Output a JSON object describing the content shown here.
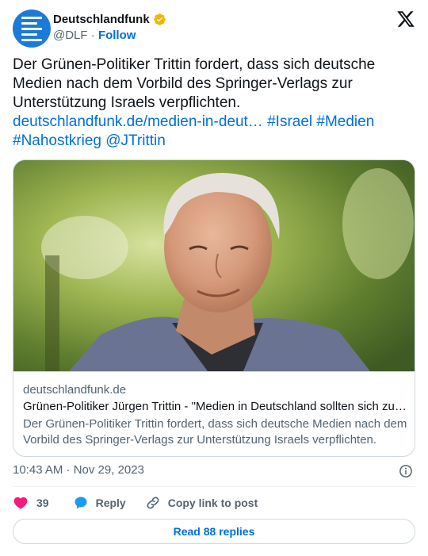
{
  "author": {
    "display_name": "Deutschlandfunk",
    "handle": "@DLF",
    "separator": " · ",
    "follow_label": "Follow",
    "verified_badge_color": "#f4b400",
    "avatar_color": "#1c7bd6"
  },
  "platform_icon": "x-logo-icon",
  "tweet": {
    "text": "Der Grünen-Politiker Trittin fordert, dass sich deutsche Medien nach dem Vorbild des Springer-Verlags zur Unterstützung Israels verpflichten.",
    "link": "deutschlandfunk.de/medien-in-deut…",
    "hashtags": [
      "#Israel",
      "#Medien",
      "#Nahostkrieg"
    ],
    "mention": "@JTrittin"
  },
  "card": {
    "image": "portrait-photo",
    "domain": "deutschlandfunk.de",
    "title": "Grünen-Politiker Jürgen Trittin - \"Medien in Deutschland sollten sich zur…",
    "description": "Der Grünen-Politiker Trittin fordert, dass sich deutsche Medien nach dem Vorbild des Springer-Verlags zur Unterstützung Israels verpflichten."
  },
  "meta": {
    "time": "10:43 AM · Nov 29, 2023"
  },
  "actions": {
    "like_count": "39",
    "reply_label": "Reply",
    "copy_label": "Copy link to post",
    "like_color": "#f91880",
    "reply_color": "#1d9bf0"
  },
  "replies_button": "Read 88 replies",
  "colors": {
    "link": "#006fd6",
    "text": "#0f1419",
    "secondary": "#536471",
    "border": "#cfd9de"
  }
}
